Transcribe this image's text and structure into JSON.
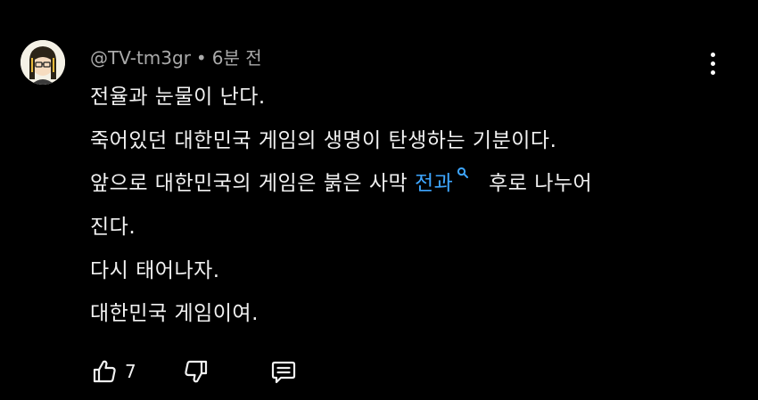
{
  "comment": {
    "author": "@TV-tm3gr",
    "separator": "•",
    "time": "6분 전",
    "lines": [
      "전율과 눈물이 난다.",
      "죽어있던 대한민국 게임의 생명이 탄생하는 기분이다.",
      "앞으로 대한민국의 게임은 붉은 사막 ",
      "진다.",
      "다시 태어나자.",
      "대한민국 게임이여."
    ],
    "tag_link": "전과",
    "line3_after": " 후로 나누어",
    "like_count": "7"
  },
  "icons": {
    "avatar": "cartoon-avatar",
    "more": "more-vertical-icon",
    "tag": "search-icon",
    "like": "thumbs-up-icon",
    "dislike": "thumbs-down-icon",
    "reply": "comment-reply-icon"
  },
  "colors": {
    "background": "#000000",
    "text": "#f1f1f1",
    "meta": "#aaaaaa",
    "link": "#3ea6ff"
  }
}
